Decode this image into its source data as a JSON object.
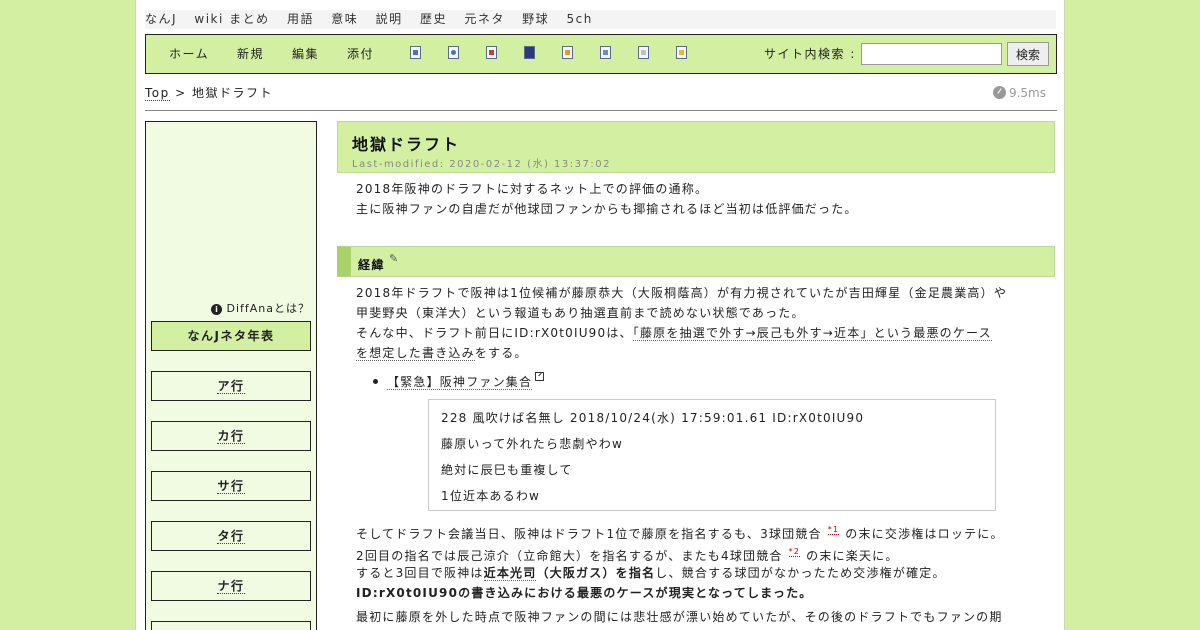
{
  "tagbar": [
    "なんJ",
    "wiki まとめ",
    "用語",
    "意味",
    "説明",
    "歴史",
    "元ネタ",
    "野球",
    "5ch"
  ],
  "toolbar": {
    "links": [
      "ホーム",
      "新規",
      "編集",
      "添付"
    ],
    "icons": [
      "new-page-icon",
      "search-page-icon",
      "diff-icon",
      "save-icon",
      "lock-icon",
      "copy-icon",
      "list-icon",
      "help-icon"
    ],
    "search_label": "サイト内検索 :",
    "search_placeholder": "",
    "search_button": "検索"
  },
  "breadcrumb": {
    "top": "Top",
    "sep": ">",
    "current": "地獄ドラフト"
  },
  "timing": "9.5ms",
  "sidebar": {
    "diffana": "DiffAnaとは？",
    "items": [
      "なんJネタ年表",
      "ア行",
      "カ行",
      "サ行",
      "タ行",
      "ナ行"
    ]
  },
  "article": {
    "title": "地獄ドラフト",
    "last_modified": "Last-modified: 2020-02-12 (水) 13:37:02",
    "intro": [
      "2018年阪神のドラフトに対するネット上での評価の通称。",
      "主に阪神ファンの自虐だが他球団ファンからも揶揄されるほど当初は低評価だった。"
    ],
    "section_title": "経緯",
    "p1_line1": "2018年ドラフトで阪神は1位候補が藤原恭大（大阪桐蔭高）が有力視されていたが吉田輝星（金足農業高）や",
    "p1_line2": "甲斐野央（東洋大）という報道もあり抽選直前まで読めない状態であった。",
    "p1_line3_pre": "そんな中、ドラフト前日にID:rX0t0IU90は、",
    "p1_line3_link": "「藤原を抽選で外す→辰己も外す→近本」という最悪のケース",
    "p1_line4_link": "を想定した書き込み",
    "p1_line4_post": "をする。",
    "bullet_link": "【緊急】阪神ファン集合",
    "quote": [
      "228 風吹けば名無し 2018/10/24(水) 17:59:01.61 ID:rX0t0IU90",
      "藤原いって外れたら悲劇やわw",
      "絶対に辰巳も重複して",
      "1位近本あるわw"
    ],
    "p2_line1_pre": "そしてドラフト会議当日、阪神はドラフト1位で藤原を指名するも、3球団競合",
    "fn1": "*1",
    "p2_line1_post": "の末に交渉権はロッテに。",
    "p2_line2_pre": "2回目の指名では辰己涼介（立命館大）を指名するが、またも4球団競合",
    "fn2": "*2",
    "p2_line2_post": "の末に楽天に。",
    "p2_line3_pre": "すると3回目で阪神は",
    "p2_line3_link": "近本光司",
    "p2_line3_bold": "（大阪ガス）を指名",
    "p2_line3_post": "し、競合する球団がなかったため交渉権が確定。",
    "p2_line4": "ID:rX0t0IU90の書き込みにおける最悪のケースが現実となってしまった。",
    "p3_line1": "最初に藤原を外した時点で阪神ファンの間には悲壮感が漂い始めていたが、その後のドラフトでもファンの期"
  }
}
